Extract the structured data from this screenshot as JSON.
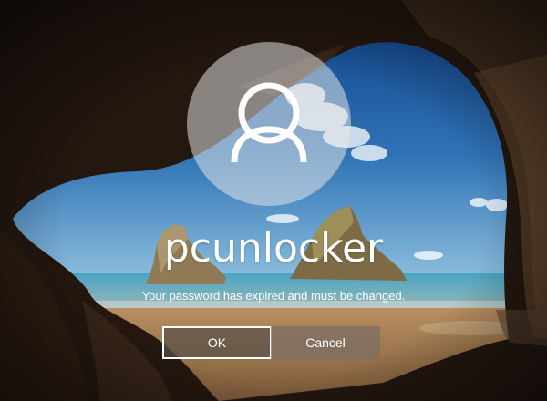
{
  "user": {
    "name": "pcunlocker",
    "avatar_icon": "user-silhouette-icon"
  },
  "message": "Your password has expired and must be changed.",
  "buttons": {
    "ok_label": "OK",
    "cancel_label": "Cancel"
  },
  "colors": {
    "sky": "#2d6fb0",
    "sea": "#2f8fb0",
    "sand": "#b48a5c",
    "cave": "#1a120c",
    "button": "#5a5048"
  }
}
